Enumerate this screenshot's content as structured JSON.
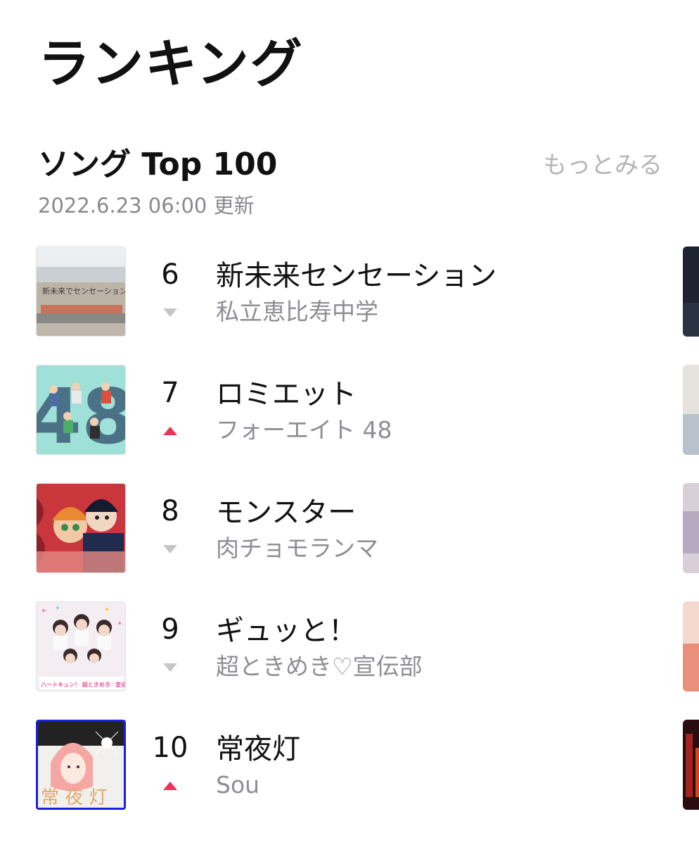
{
  "page": {
    "title": "ランキング"
  },
  "section": {
    "title": "ソング Top 100",
    "more_label": "もっとみる",
    "updated": "2022.6.23 06:00 更新"
  },
  "songs": [
    {
      "rank": "6",
      "title": "新未来センセーション",
      "artist": "私立恵比寿中学",
      "trend": "down",
      "art_text": "新未来でセンセーション"
    },
    {
      "rank": "7",
      "title": "ロミエット",
      "artist": "フォーエイト 48",
      "trend": "up",
      "art_text": "48"
    },
    {
      "rank": "8",
      "title": "モンスター",
      "artist": "肉チョモランマ",
      "trend": "down"
    },
    {
      "rank": "9",
      "title": "ギュッと！",
      "artist": "超ときめき♡宣伝部",
      "trend": "down",
      "art_text": "ハートキュン！ 超ときめき♡宣伝部"
    },
    {
      "rank": "10",
      "title": "常夜灯",
      "artist": "Sou",
      "trend": "up",
      "art_text": "常 夜 灯"
    }
  ],
  "colors": {
    "up": "#e8335a",
    "down": "#c6c6c8",
    "more": "#b5b5b5",
    "secondary_text": "#8e8e93"
  }
}
